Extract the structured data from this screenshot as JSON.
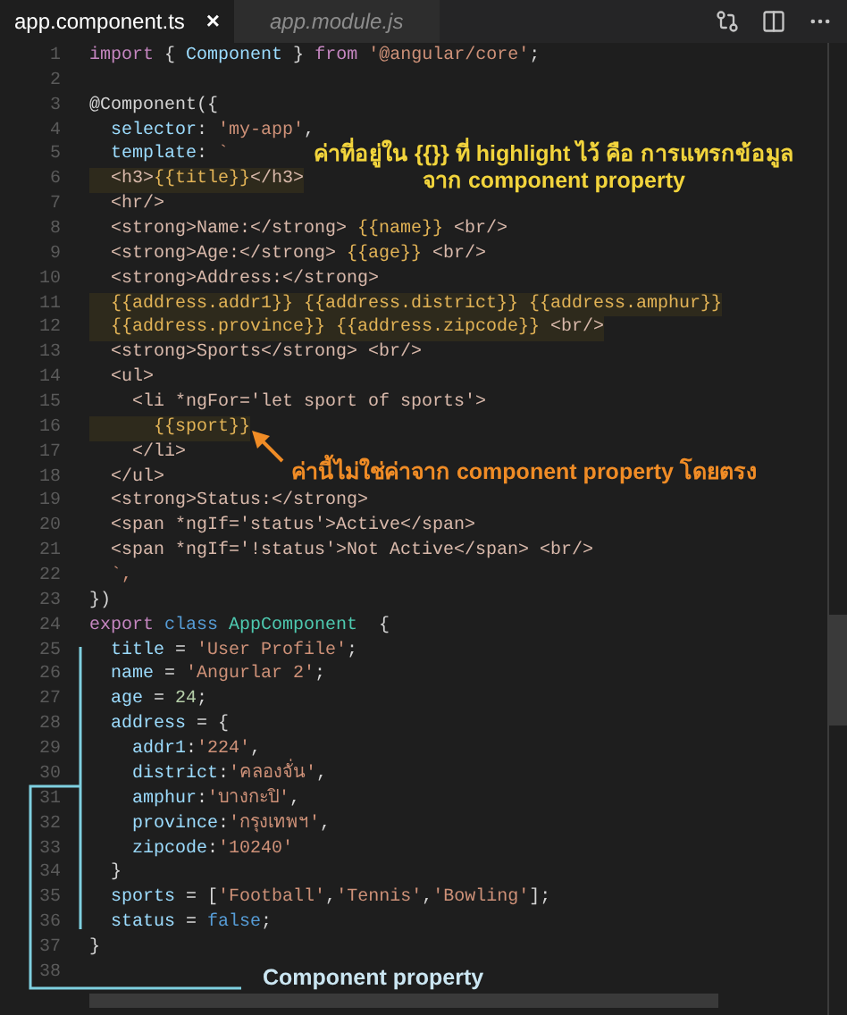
{
  "tabs": [
    {
      "label": "app.component.ts",
      "selected": true,
      "close": "×"
    },
    {
      "label": "app.module.js",
      "selected": false
    }
  ],
  "editor": {
    "lines": [
      {
        "num": "1",
        "tokens": [
          {
            "kind": "kw",
            "text": "import"
          },
          {
            "kind": "plain",
            "text": " { "
          },
          {
            "kind": "var",
            "text": "Component"
          },
          {
            "kind": "plain",
            "text": " } "
          },
          {
            "kind": "kw",
            "text": "from"
          },
          {
            "kind": "str",
            "text": " '@angular/core'"
          },
          {
            "kind": "plain",
            "text": ";"
          }
        ]
      },
      {
        "num": "2"
      },
      {
        "num": "3",
        "tokens": [
          {
            "kind": "plain",
            "text": "@Component({"
          }
        ]
      },
      {
        "num": "4",
        "tokens": [
          {
            "kind": "var",
            "text": "  selector"
          },
          {
            "kind": "plain",
            "text": ": "
          },
          {
            "kind": "str",
            "text": "'my-app'"
          },
          {
            "kind": "plain",
            "text": ","
          }
        ]
      },
      {
        "num": "5",
        "tokens": [
          {
            "kind": "var",
            "text": "  template"
          },
          {
            "kind": "plain",
            "text": ": "
          },
          {
            "kind": "str",
            "text": "`"
          }
        ]
      },
      {
        "num": "6",
        "highlighted": true,
        "tokens": [
          {
            "kind": "tag",
            "text": "  <h3>"
          },
          {
            "kind": "interp",
            "text": "{{title}}"
          },
          {
            "kind": "tag",
            "text": "</h3>"
          }
        ]
      },
      {
        "num": "7",
        "tokens": [
          {
            "kind": "tag",
            "text": "  <hr/>"
          }
        ]
      },
      {
        "num": "8",
        "tokens": [
          {
            "kind": "tag",
            "text": "  <strong>Name:</strong> "
          },
          {
            "kind": "interp",
            "text": "{{name}}"
          },
          {
            "kind": "tag",
            "text": " <br/>"
          }
        ]
      },
      {
        "num": "9",
        "tokens": [
          {
            "kind": "tag",
            "text": "  <strong>Age:</strong> "
          },
          {
            "kind": "interp",
            "text": "{{age}}"
          },
          {
            "kind": "tag",
            "text": " <br/>"
          }
        ]
      },
      {
        "num": "10",
        "tokens": [
          {
            "kind": "tag",
            "text": "  <strong>Address:</strong>"
          }
        ]
      },
      {
        "num": "11",
        "highlighted": true,
        "tokens": [
          {
            "kind": "interp",
            "text": "  {{address.addr1}} {{address.district}} {{address.amphur}}"
          }
        ]
      },
      {
        "num": "12",
        "highlighted": true,
        "tokens": [
          {
            "kind": "interp",
            "text": "  {{address.province}} {{address.zipcode}}"
          },
          {
            "kind": "tag",
            "text": " <br/>"
          }
        ]
      },
      {
        "num": "13",
        "tokens": [
          {
            "kind": "tag",
            "text": "  <strong>Sports</strong> <br/>"
          }
        ]
      },
      {
        "num": "14",
        "tokens": [
          {
            "kind": "tag",
            "text": "  <ul>"
          }
        ]
      },
      {
        "num": "15",
        "tokens": [
          {
            "kind": "tag",
            "text": "    <li *ngFor='let sport of sports'>"
          }
        ]
      },
      {
        "num": "16",
        "highlighted": true,
        "tokens": [
          {
            "kind": "interp",
            "text": "      {{sport}}"
          }
        ]
      },
      {
        "num": "17",
        "tokens": [
          {
            "kind": "tag",
            "text": "    </li>"
          }
        ]
      },
      {
        "num": "18",
        "tokens": [
          {
            "kind": "tag",
            "text": "  </ul>"
          }
        ]
      },
      {
        "num": "19",
        "tokens": [
          {
            "kind": "tag",
            "text": "  <strong>Status:</strong>"
          }
        ]
      },
      {
        "num": "20",
        "tokens": [
          {
            "kind": "tag",
            "text": "  <span *ngIf='status'>Active</span>"
          }
        ]
      },
      {
        "num": "21",
        "tokens": [
          {
            "kind": "tag",
            "text": "  <span *ngIf='!status'>Not Active</span> <br/>"
          }
        ]
      },
      {
        "num": "22",
        "tokens": [
          {
            "kind": "str",
            "text": "  `,"
          }
        ]
      },
      {
        "num": "23",
        "tokens": [
          {
            "kind": "plain",
            "text": "})"
          }
        ]
      },
      {
        "num": "24",
        "tokens": [
          {
            "kind": "kw",
            "text": "export "
          },
          {
            "kind": "kw2",
            "text": "class "
          },
          {
            "kind": "cls",
            "text": "AppComponent"
          },
          {
            "kind": "plain",
            "text": "  {"
          }
        ]
      },
      {
        "num": "25",
        "tokens": [
          {
            "kind": "var",
            "text": "  title"
          },
          {
            "kind": "plain",
            "text": " = "
          },
          {
            "kind": "str",
            "text": "'User Profile'"
          },
          {
            "kind": "plain",
            "text": ";"
          }
        ]
      },
      {
        "num": "26",
        "tokens": [
          {
            "kind": "var",
            "text": "  name"
          },
          {
            "kind": "plain",
            "text": " = "
          },
          {
            "kind": "str",
            "text": "'Angurlar 2'"
          },
          {
            "kind": "plain",
            "text": ";"
          }
        ]
      },
      {
        "num": "27",
        "tokens": [
          {
            "kind": "var",
            "text": "  age"
          },
          {
            "kind": "plain",
            "text": " = "
          },
          {
            "kind": "num",
            "text": "24"
          },
          {
            "kind": "plain",
            "text": ";"
          }
        ]
      },
      {
        "num": "28",
        "tokens": [
          {
            "kind": "var",
            "text": "  address"
          },
          {
            "kind": "plain",
            "text": " = {"
          }
        ]
      },
      {
        "num": "29",
        "tokens": [
          {
            "kind": "var",
            "text": "    addr1"
          },
          {
            "kind": "plain",
            "text": ":"
          },
          {
            "kind": "str",
            "text": "'224'"
          },
          {
            "kind": "plain",
            "text": ","
          }
        ]
      },
      {
        "num": "30",
        "tokens": [
          {
            "kind": "var",
            "text": "    district"
          },
          {
            "kind": "plain",
            "text": ":"
          },
          {
            "kind": "str",
            "text": "'คลองจั่น'"
          },
          {
            "kind": "plain",
            "text": ","
          }
        ]
      },
      {
        "num": "31",
        "tokens": [
          {
            "kind": "var",
            "text": "    amphur"
          },
          {
            "kind": "plain",
            "text": ":"
          },
          {
            "kind": "str",
            "text": "'บางกะปิ'"
          },
          {
            "kind": "plain",
            "text": ","
          }
        ]
      },
      {
        "num": "32",
        "tokens": [
          {
            "kind": "var",
            "text": "    province"
          },
          {
            "kind": "plain",
            "text": ":"
          },
          {
            "kind": "str",
            "text": "'กรุงเทพฯ'"
          },
          {
            "kind": "plain",
            "text": ","
          }
        ]
      },
      {
        "num": "33",
        "tokens": [
          {
            "kind": "var",
            "text": "    zipcode"
          },
          {
            "kind": "plain",
            "text": ":"
          },
          {
            "kind": "str",
            "text": "'10240'"
          }
        ]
      },
      {
        "num": "34",
        "tokens": [
          {
            "kind": "plain",
            "text": "  }"
          }
        ]
      },
      {
        "num": "35",
        "tokens": [
          {
            "kind": "var",
            "text": "  sports"
          },
          {
            "kind": "plain",
            "text": " = ["
          },
          {
            "kind": "str",
            "text": "'Football'"
          },
          {
            "kind": "plain",
            "text": ","
          },
          {
            "kind": "str",
            "text": "'Tennis'"
          },
          {
            "kind": "plain",
            "text": ","
          },
          {
            "kind": "str",
            "text": "'Bowling'"
          },
          {
            "kind": "plain",
            "text": "];"
          }
        ]
      },
      {
        "num": "36",
        "tokens": [
          {
            "kind": "var",
            "text": "  status"
          },
          {
            "kind": "plain",
            "text": " = "
          },
          {
            "kind": "kw2",
            "text": "false"
          },
          {
            "kind": "plain",
            "text": ";"
          }
        ]
      },
      {
        "num": "37",
        "tokens": [
          {
            "kind": "plain",
            "text": "}"
          }
        ]
      },
      {
        "num": "38"
      }
    ]
  },
  "annotations": [
    {
      "kind": "highlight-note",
      "lines": [
        "ค่าที่อยู่ใน {{}} ที่ highlight ไว้ คือ การแทรกข้อมูล",
        "จาก component property"
      ]
    },
    {
      "kind": "arrow-note",
      "lines": [
        "ค่านี้ไม่ใช่ค่าจาก component property โดยตรง"
      ]
    },
    {
      "kind": "bracket-note",
      "lines": [
        "Component property"
      ]
    }
  ]
}
